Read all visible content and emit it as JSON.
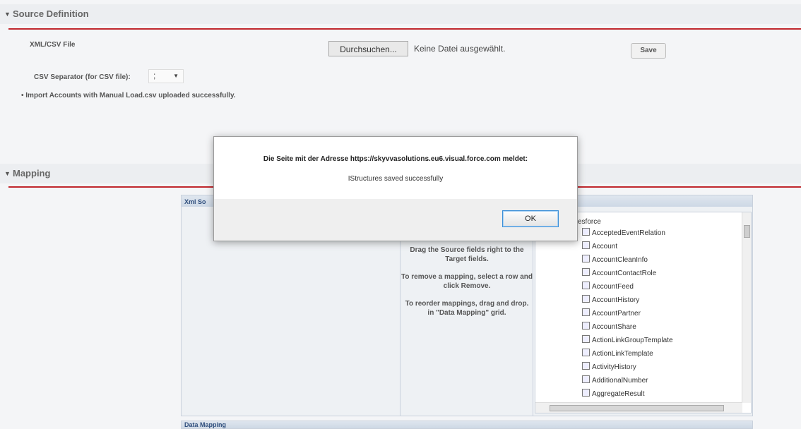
{
  "source_definition": {
    "title": "Source Definition",
    "file_label": "XML/CSV File",
    "browse_label": "Durchsuchen...",
    "no_file_text": "Keine Datei ausgewählt.",
    "save_label": "Save",
    "separator_label": "CSV Separator (for CSV file):",
    "separator_value": ";",
    "status_message": "• Import Accounts with Manual Load.csv uploaded successfully."
  },
  "mapping": {
    "title": "Mapping",
    "source_panel_title": "Xml So",
    "instructions": [
      "Drag the Source fields right to the Target fields.",
      "To remove a mapping, select a row and click Remove.",
      "To reorder mappings, drag and drop. in \"Data Mapping\" grid."
    ],
    "tree_root": "esforce",
    "tree_items": [
      "AcceptedEventRelation",
      "Account",
      "AccountCleanInfo",
      "AccountContactRole",
      "AccountFeed",
      "AccountHistory",
      "AccountPartner",
      "AccountShare",
      "ActionLinkGroupTemplate",
      "ActionLinkTemplate",
      "ActivityHistory",
      "AdditionalNumber",
      "AggregateResult"
    ],
    "data_mapping_title": "Data Mapping"
  },
  "dialog": {
    "message": "Die Seite mit der Adresse https://skyvvasolutions.eu6.visual.force.com meldet:",
    "sub_message": "IStructures saved successfully",
    "ok_label": "OK"
  }
}
